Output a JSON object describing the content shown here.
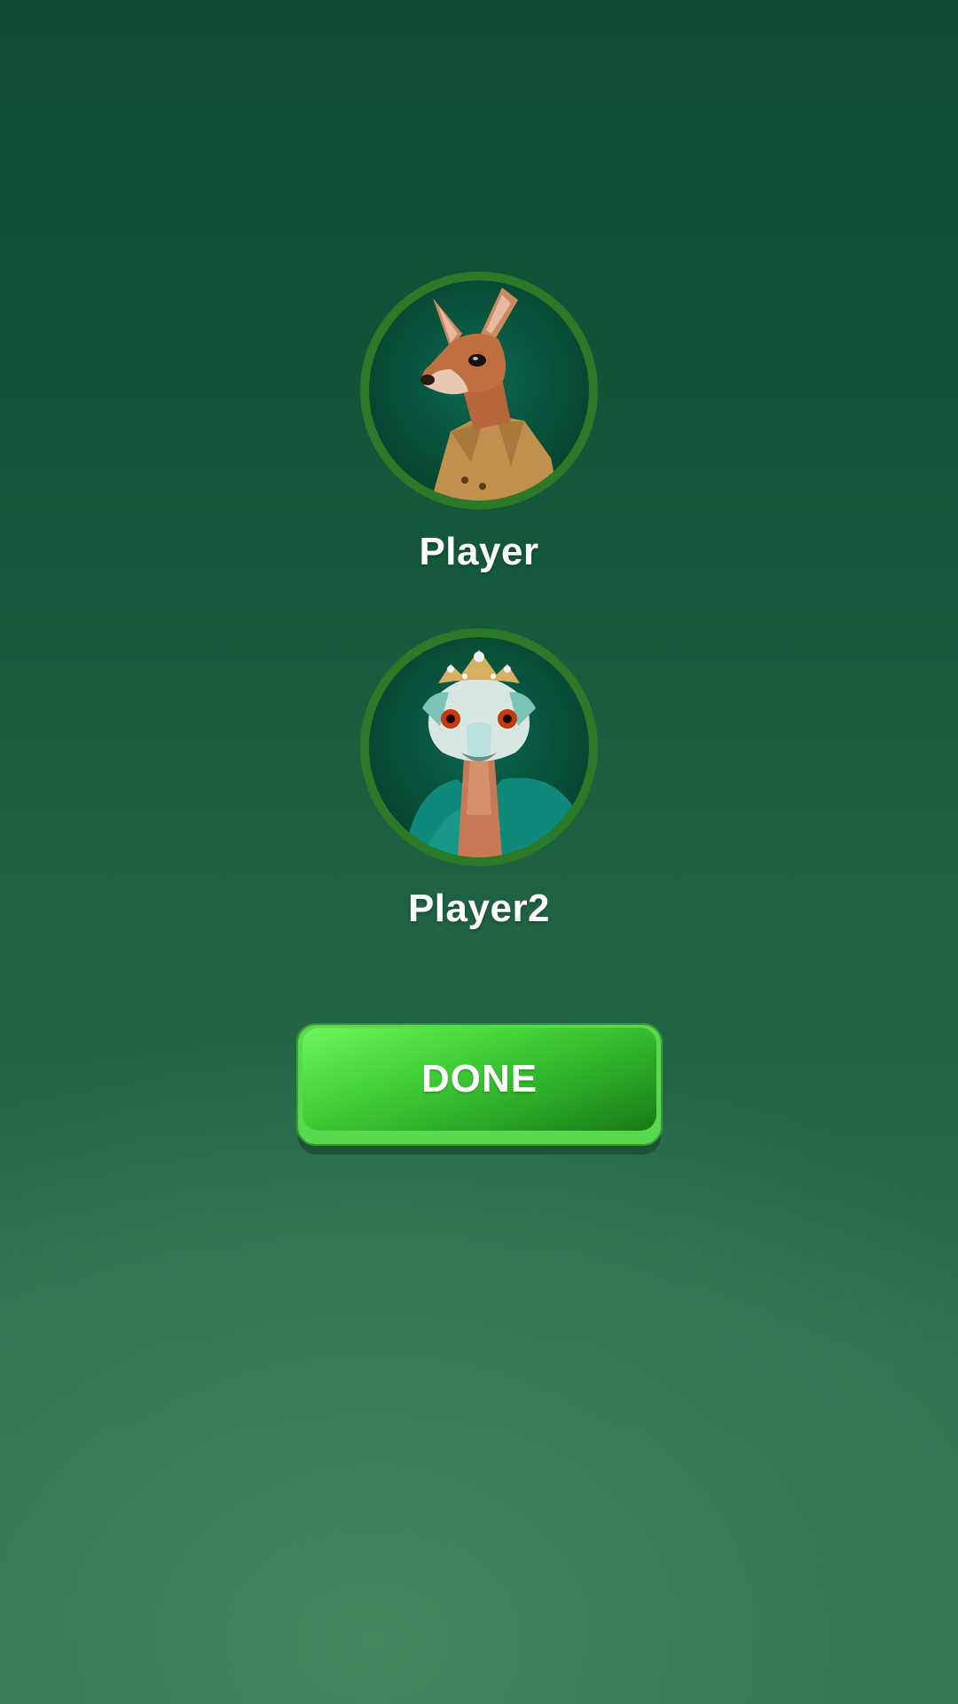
{
  "players": [
    {
      "name": "Player",
      "avatar": "kangaroo-in-trench-coat"
    },
    {
      "name": "Player2",
      "avatar": "ostrich-with-tiara"
    }
  ],
  "done_button": {
    "label": "DONE"
  },
  "colors": {
    "avatar_ring": "#2a7a27",
    "button_green": "#43d43a",
    "background": "#155a3c"
  }
}
